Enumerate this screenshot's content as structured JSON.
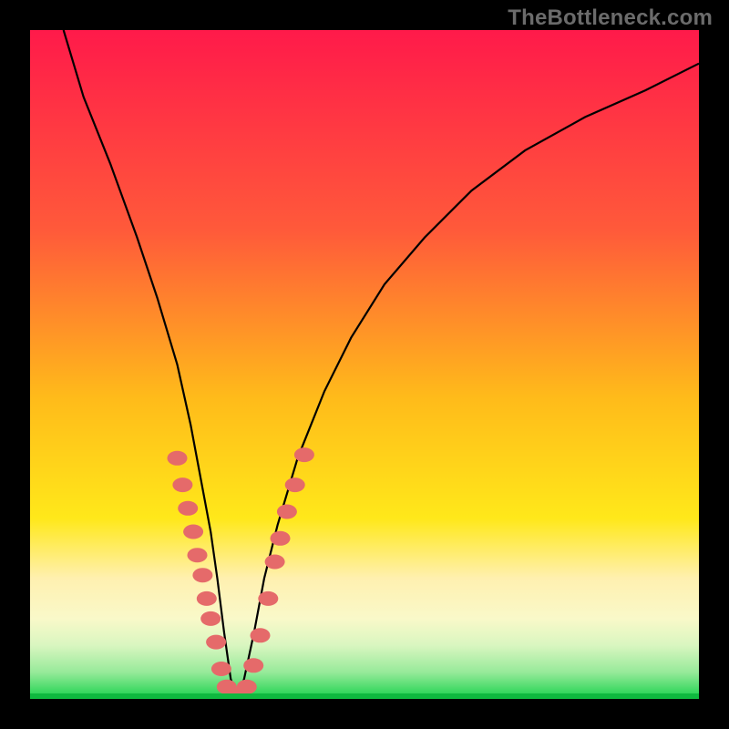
{
  "watermark": "TheBottleneck.com",
  "chart_data": {
    "type": "line",
    "title": "",
    "xlabel": "",
    "ylabel": "",
    "xlim": [
      0,
      100
    ],
    "ylim": [
      0,
      100
    ],
    "series": [
      {
        "name": "bottleneck-curve",
        "x": [
          5,
          8,
          12,
          16,
          19,
          22,
          24,
          25.5,
          27,
          28,
          29,
          30,
          31,
          32,
          33.5,
          35,
          37,
          40,
          44,
          48,
          53,
          59,
          66,
          74,
          83,
          92,
          100
        ],
        "values": [
          100,
          90,
          80,
          69,
          60,
          50,
          41,
          33,
          25,
          18,
          10,
          3,
          0,
          3,
          10,
          18,
          26,
          36,
          46,
          54,
          62,
          69,
          76,
          82,
          87,
          91,
          95
        ]
      }
    ],
    "scatter_points": {
      "name": "sample-points",
      "color": "#e56a6a",
      "points": [
        {
          "x": 22.0,
          "y": 36.0
        },
        {
          "x": 22.8,
          "y": 32.0
        },
        {
          "x": 23.6,
          "y": 28.5
        },
        {
          "x": 24.4,
          "y": 25.0
        },
        {
          "x": 25.0,
          "y": 21.5
        },
        {
          "x": 25.8,
          "y": 18.5
        },
        {
          "x": 26.4,
          "y": 15.0
        },
        {
          "x": 27.0,
          "y": 12.0
        },
        {
          "x": 27.8,
          "y": 8.5
        },
        {
          "x": 28.6,
          "y": 4.5
        },
        {
          "x": 29.4,
          "y": 1.8
        },
        {
          "x": 30.4,
          "y": 0.8
        },
        {
          "x": 31.4,
          "y": 0.8
        },
        {
          "x": 32.4,
          "y": 1.8
        },
        {
          "x": 33.4,
          "y": 5.0
        },
        {
          "x": 34.4,
          "y": 9.5
        },
        {
          "x": 35.6,
          "y": 15.0
        },
        {
          "x": 36.6,
          "y": 20.5
        },
        {
          "x": 37.4,
          "y": 24.0
        },
        {
          "x": 38.4,
          "y": 28.0
        },
        {
          "x": 39.6,
          "y": 32.0
        },
        {
          "x": 41.0,
          "y": 36.5
        }
      ]
    }
  }
}
